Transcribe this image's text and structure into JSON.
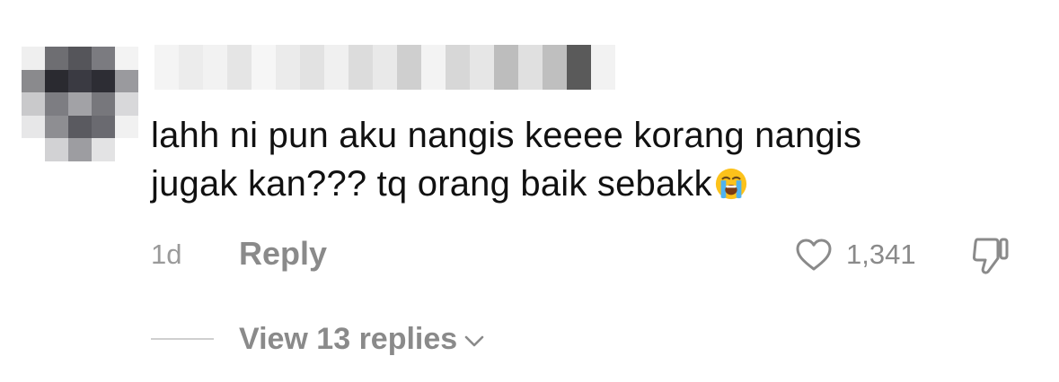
{
  "comment": {
    "text_line_1": "lahh ni pun aku nangis keeee korang nangis",
    "text_line_2": "jugak kan??? tq orang baik sebakk",
    "emoji": "loudly-crying-face-icon",
    "timestamp": "1d",
    "reply_label": "Reply",
    "like_count": "1,341",
    "view_replies_label": "View 13 replies"
  },
  "colors": {
    "text": "#111111",
    "muted": "#8a8a8a",
    "timestamp": "#9a9a9a",
    "divider": "#cfcfcf"
  },
  "icons": {
    "like": "heart-outline-icon",
    "dislike": "thumbs-down-outline-icon",
    "expand": "chevron-down-icon"
  }
}
